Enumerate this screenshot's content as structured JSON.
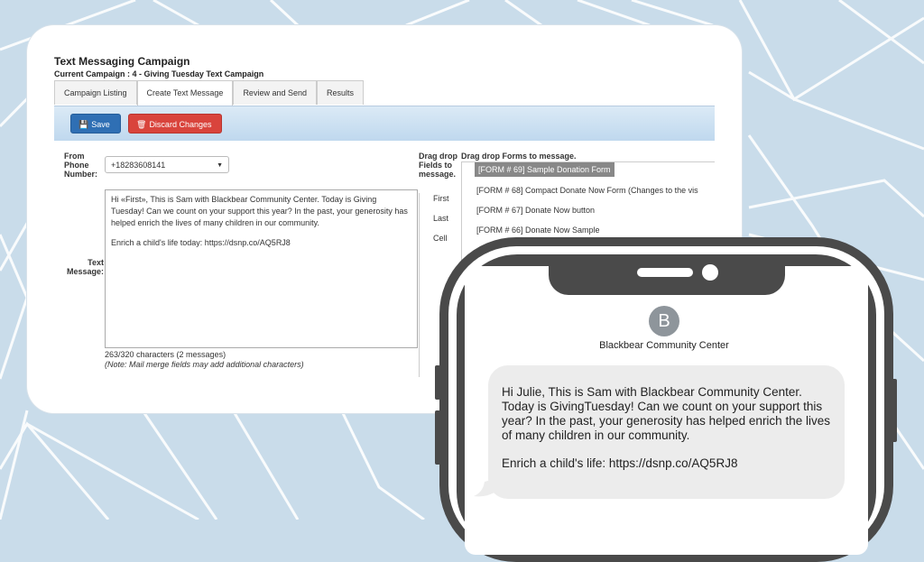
{
  "app": {
    "title": "Text Messaging Campaign",
    "current_campaign": "Current Campaign : 4 - Giving Tuesday Text Campaign"
  },
  "tabs": [
    {
      "label": "Campaign Listing"
    },
    {
      "label": "Create Text Message",
      "active": true
    },
    {
      "label": "Review and Send"
    },
    {
      "label": "Results"
    }
  ],
  "toolbar": {
    "save_label": "Save",
    "discard_label": "Discard Changes"
  },
  "form": {
    "from_label": "From Phone Number:",
    "from_value": "+18283608141",
    "text_label": "Text Message:",
    "message_lines": [
      "Hi «First», This is Sam with Blackbear Community Center. Today is Giving Tuesday! Can we count on your support this year? In the past, your generosity has helped enrich the lives of many children in our community.",
      "Enrich a child's life today:   https://dsnp.co/AQ5RJ8"
    ],
    "char_count": "263/320 characters (2 messages)",
    "note": "(Note: Mail merge fields may add additional characters)"
  },
  "merge_fields": {
    "label": "Drag drop Fields to message.",
    "items": [
      "First",
      "Last",
      "Cell"
    ]
  },
  "forms_panel": {
    "label": "Drag drop Forms to message.",
    "items": [
      {
        "label": "[FORM # 69] Sample Donation Form",
        "selected": true
      },
      {
        "label": "[FORM # 68] Compact Donate Now Form (Changes to the vis"
      },
      {
        "label": "[FORM # 67] Donate Now button"
      },
      {
        "label": "[FORM # 66] Donate Now Sample"
      }
    ]
  },
  "phone_preview": {
    "avatar_letter": "B",
    "contact_name": "Blackbear Community Center",
    "message_paragraph_1": "Hi Julie, This is Sam with Blackbear Community Center. Today is GivingTuesday! Can we count on your support this year? In the past, your generosity has helped enrich the lives of many children in our community.",
    "message_paragraph_2": "Enrich a child's life: https://dsnp.co/AQ5RJ8"
  },
  "colors": {
    "background": "#c9dcea",
    "save_button": "#2f6fb4",
    "discard_button": "#d9443c",
    "phone_frame": "#4a4a4a",
    "bubble": "#ececec"
  },
  "icons": {
    "save": "floppy-disk-icon",
    "discard": "trash-icon",
    "dropdown": "caret-down-icon"
  }
}
